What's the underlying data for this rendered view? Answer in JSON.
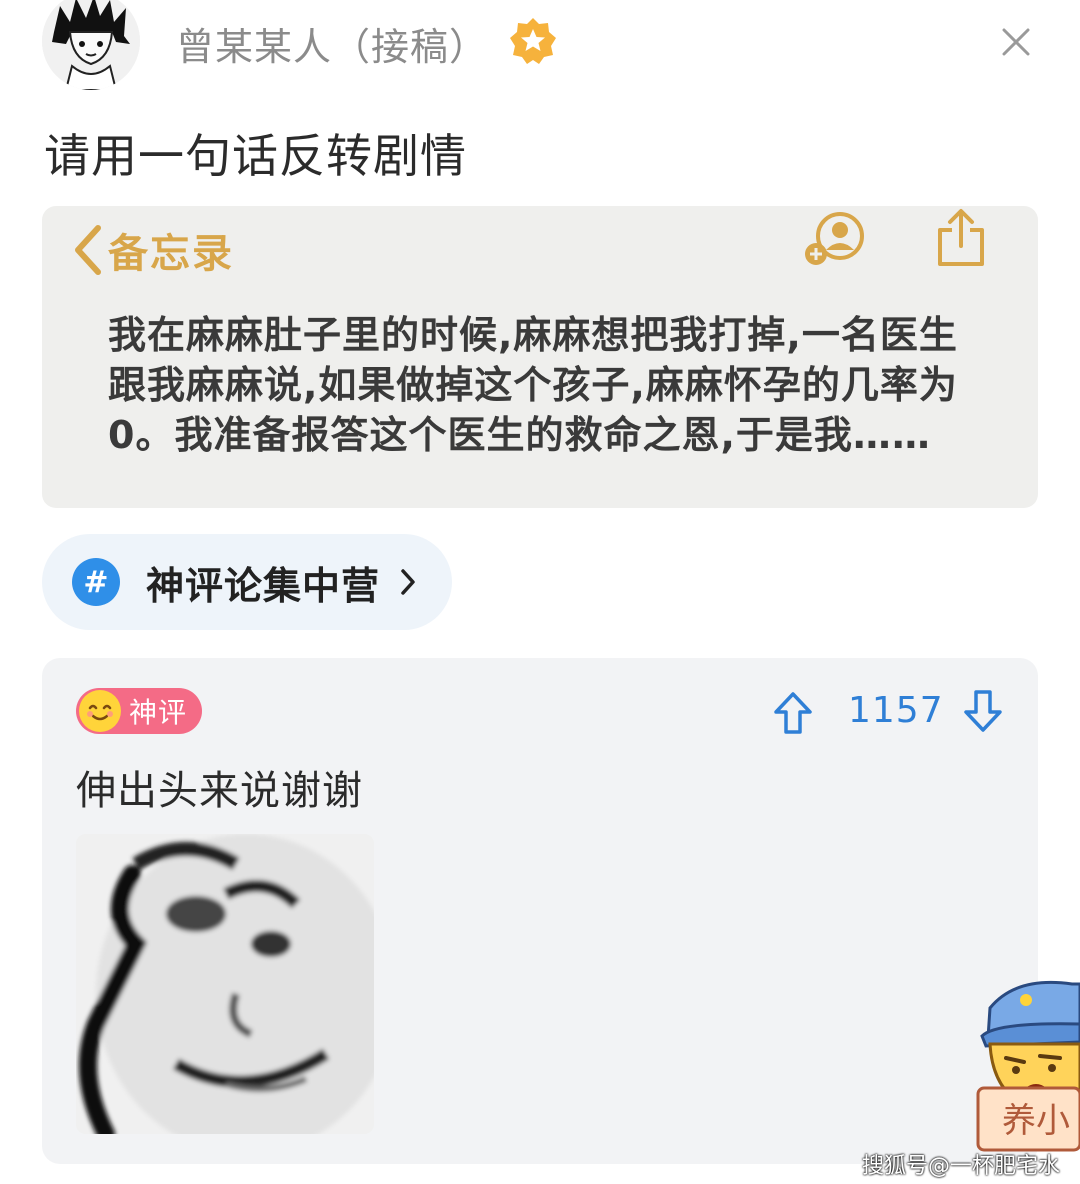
{
  "header": {
    "username": "曾某某人（接稿）",
    "badge_icon": "vip-star-icon",
    "close_icon": "close-icon"
  },
  "post": {
    "title": "请用一句话反转剧情"
  },
  "memo": {
    "back_label": "备忘录",
    "text": "我在麻麻肚子里的时候,麻麻想把我打掉,一名医生跟我麻麻说,如果做掉这个孩子,麻麻怀孕的几率为 0。我准备报答这个医生的救命之恩,于是我……",
    "accent_color": "#d8a64a"
  },
  "topic": {
    "hash": "#",
    "label": "神评论集中营",
    "color": "#2f8fe8"
  },
  "comment": {
    "badge_label": "神评",
    "vote_count": "1157",
    "text": "伸出头来说谢谢",
    "badge_color": "#f46b86",
    "vote_color": "#2f7fd6"
  },
  "mascot": {
    "sign_text": "养小"
  },
  "watermark": {
    "text": "搜狐号@一杯肥宅水"
  }
}
